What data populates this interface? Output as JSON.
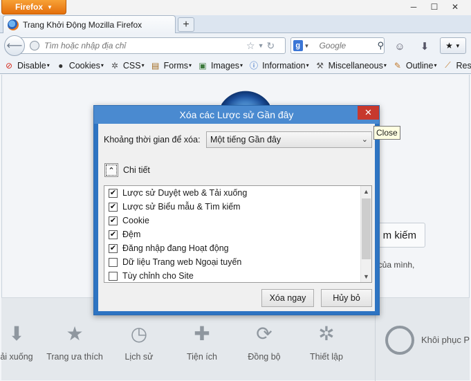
{
  "app": {
    "menu_button": "Firefox",
    "tab_title": "Trang Khởi Động Mozilla Firefox",
    "new_tab": "+"
  },
  "navbar": {
    "url_placeholder": "Tìm hoặc nhập địa chỉ",
    "search_placeholder": "Google",
    "search_engine_letter": "g"
  },
  "devtoolbar": {
    "items": [
      {
        "label": "Disable",
        "icon": "prohibited-icon",
        "color": "#d42b1e"
      },
      {
        "label": "Cookies",
        "icon": "person-icon",
        "color": "#333333"
      },
      {
        "label": "CSS",
        "icon": "gear-icon",
        "color": "#555555"
      },
      {
        "label": "Forms",
        "icon": "clipboard-icon",
        "color": "#a26a1f"
      },
      {
        "label": "Images",
        "icon": "image-icon",
        "color": "#3d7a3d"
      },
      {
        "label": "Information",
        "icon": "info-icon",
        "color": "#1f5fbf"
      },
      {
        "label": "Miscellaneous",
        "icon": "wrench-icon",
        "color": "#555555"
      },
      {
        "label": "Outline",
        "icon": "pencil-icon",
        "color": "#c0792a"
      },
      {
        "label": "Resize",
        "icon": "ruler-icon",
        "color": "#c0792a"
      }
    ]
  },
  "page": {
    "search_button": "m kiếm",
    "side_text": "t của mình,",
    "launcher": [
      {
        "label": "ải xuống",
        "icon": "download-icon"
      },
      {
        "label": "Trang ưa thích",
        "icon": "star-icon"
      },
      {
        "label": "Lịch sử",
        "icon": "clock-icon"
      },
      {
        "label": "Tiện ích",
        "icon": "puzzle-icon"
      },
      {
        "label": "Đồng bộ",
        "icon": "sync-icon"
      },
      {
        "label": "Thiết lập",
        "icon": "gear-icon"
      }
    ],
    "restore_label": "Khôi phục P"
  },
  "dialog": {
    "title": "Xóa các Lược sử Gần đây",
    "close_symbol": "✕",
    "range_label": "Khoảng thời gian để xóa:",
    "range_value": "Một tiếng Gần đây",
    "details_label": "Chi tiết",
    "items": [
      {
        "label": "Lược sử Duyệt web & Tải xuống",
        "checked": true
      },
      {
        "label": "Lược sử Biểu mẫu & Tìm kiếm",
        "checked": true
      },
      {
        "label": "Cookie",
        "checked": true
      },
      {
        "label": "Đệm",
        "checked": true
      },
      {
        "label": "Đăng nhập đang Hoạt động",
        "checked": true
      },
      {
        "label": "Dữ liệu Trang web Ngoại tuyến",
        "checked": false
      },
      {
        "label": "Tùy chỉnh cho Site",
        "checked": false
      }
    ],
    "clear_button": "Xóa ngay",
    "cancel_button": "Hủy bỏ"
  },
  "tooltip": "Close"
}
